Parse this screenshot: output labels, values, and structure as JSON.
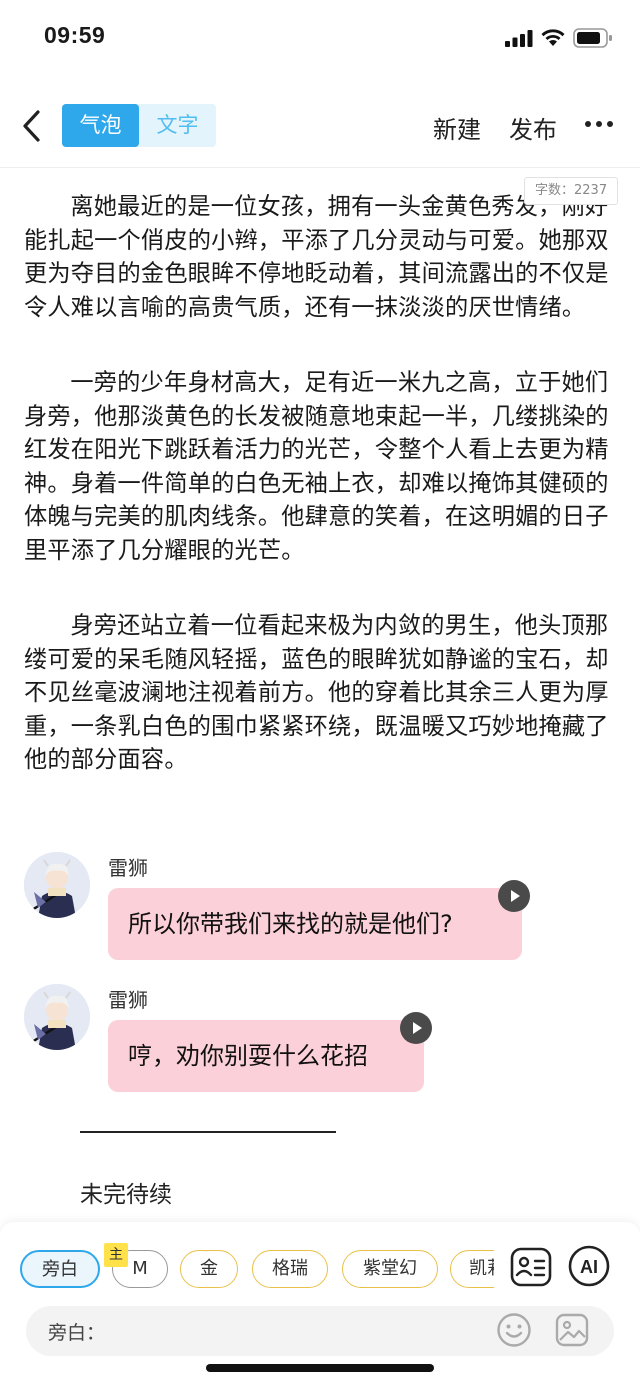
{
  "status_bar": {
    "time": "09:59"
  },
  "nav": {
    "tab_bubble": "气泡",
    "tab_text": "文字",
    "new_label": "新建",
    "publish_label": "发布",
    "accent_color": "#2ea7eb"
  },
  "word_count": "字数：2237",
  "paragraphs": [
    "离她最近的是一位女孩，拥有一头金黄色秀发，刚好能扎起一个俏皮的小辫，平添了几分灵动与可爱。她那双更为夺目的金色眼眸不停地眨动着，其间流露出的不仅是令人难以言喻的高贵气质，还有一抹淡淡的厌世情绪。",
    "一旁的少年身材高大，足有近一米九之高，立于她们身旁，他那淡黄色的长发被随意地束起一半，几缕挑染的红发在阳光下跳跃着活力的光芒，令整个人看上去更为精神。身着一件简单的白色无袖上衣，却难以掩饰其健硕的体魄与完美的肌肉线条。他肆意的笑着，在这明媚的日子里平添了几分耀眼的光芒。",
    "身旁还站立着一位看起来极为内敛的男生，他头顶那缕可爱的呆毛随风轻摇，蓝色的眼眸犹如静谧的宝石，却不见丝毫波澜地注视着前方。他的穿着比其余三人更为厚重，一条乳白色的围巾紧紧环绕，既温暖又巧妙地掩藏了他的部分面容。"
  ],
  "messages": [
    {
      "speaker": "雷狮",
      "text": "所以你带我们来找的就是他们?"
    },
    {
      "speaker": "雷狮",
      "text": "哼，劝你别耍什么花招"
    }
  ],
  "divider": "——————————",
  "to_be_continued": "未完待续",
  "characters": {
    "main_tag": "主",
    "items": [
      "旁白",
      "M",
      "金",
      "格瑞",
      "紫堂幻",
      "凯莉"
    ]
  },
  "input": {
    "label": "旁白："
  },
  "colors": {
    "bubble": "#fcd0d9",
    "chip_border": "#e9c14a"
  }
}
